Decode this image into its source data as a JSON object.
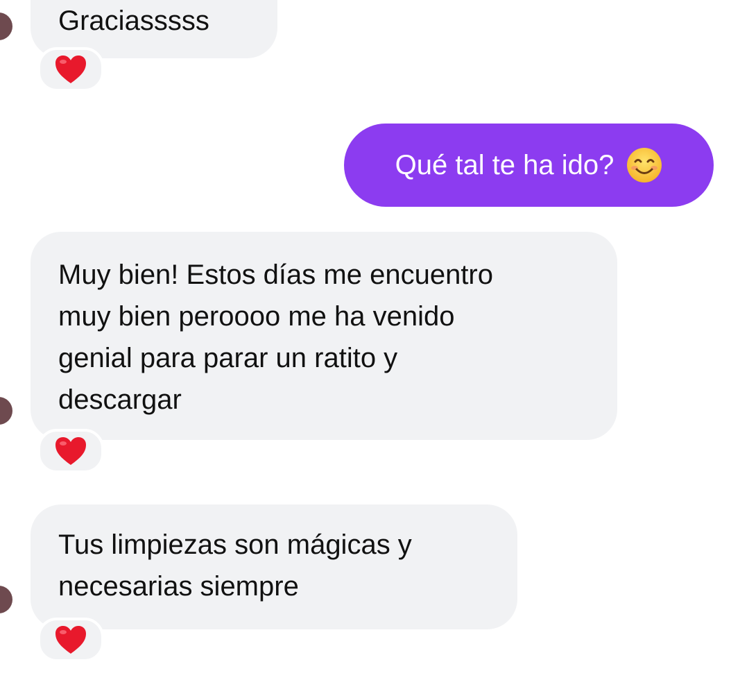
{
  "messages": [
    {
      "id": "m1",
      "direction": "incoming",
      "lines": [
        "Graciasssss"
      ],
      "reaction": "heart-icon"
    },
    {
      "id": "m2",
      "direction": "outgoing",
      "text": "Qué tal te ha ido?",
      "emoji": "smiling-face-icon"
    },
    {
      "id": "m3",
      "direction": "incoming",
      "lines": [
        "Muy bien! Estos días me encuentro",
        "muy bien peroooo me ha venido",
        "genial para parar un ratito y",
        "descargar"
      ],
      "reaction": "heart-icon"
    },
    {
      "id": "m4",
      "direction": "incoming",
      "lines": [
        "Tus limpiezas son mágicas y",
        "necesarias siempre"
      ],
      "reaction": "heart-icon"
    }
  ],
  "colors": {
    "outgoing_bubble": "#8c3cf0",
    "incoming_bubble": "#f1f2f4",
    "avatar": "#6e4a4f",
    "heart": "#e8192c"
  }
}
